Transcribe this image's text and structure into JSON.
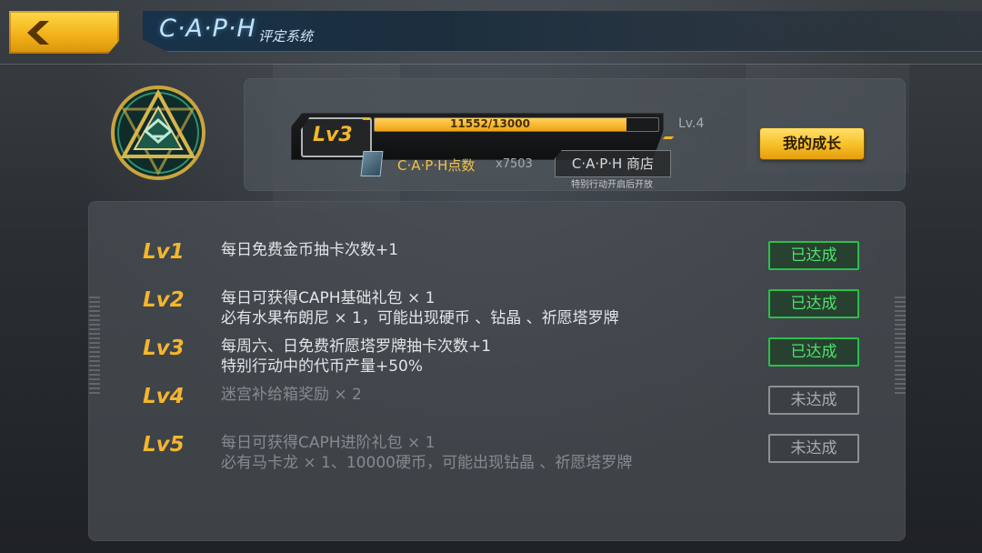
{
  "header": {
    "title": "C·A·P·H",
    "subtitle": "评定系统"
  },
  "status": {
    "current_level": "Lv3",
    "xp_text": "11552/13000",
    "xp_progress": 0.8886,
    "next_level": "Lv.4",
    "points_label": "C·A·P·H点数",
    "points_value": "x7503",
    "shop_label": "C·A·P·H 商店",
    "shop_note": "特别行动开启后开放",
    "growth_button": "我的成长"
  },
  "rewards": [
    {
      "level": "Lv1",
      "lines": [
        "每日免费金币抽卡次数+1"
      ],
      "status": "已达成",
      "achieved": true
    },
    {
      "level": "Lv2",
      "lines": [
        "每日可获得CAPH基础礼包 × 1",
        "必有水果布朗尼 × 1，可能出现硬币 、钻晶 、祈愿塔罗牌"
      ],
      "status": "已达成",
      "achieved": true
    },
    {
      "level": "Lv3",
      "lines": [
        "每周六、日免费祈愿塔罗牌抽卡次数+1",
        "特别行动中的代币产量+50%"
      ],
      "status": "已达成",
      "achieved": true
    },
    {
      "level": "Lv4",
      "lines": [
        "迷宫补给箱奖励 × 2"
      ],
      "status": "未达成",
      "achieved": false
    },
    {
      "level": "Lv5",
      "lines": [
        "每日可获得CAPH进阶礼包 × 1",
        "必有马卡龙 × 1、10000硬币，可能出现钻晶 、祈愿塔罗牌"
      ],
      "status": "未达成",
      "achieved": false
    }
  ],
  "colors": {
    "accent_gold": "#f3b62c",
    "achieved_green": "#29c04a",
    "locked_gray": "#8d9195"
  }
}
